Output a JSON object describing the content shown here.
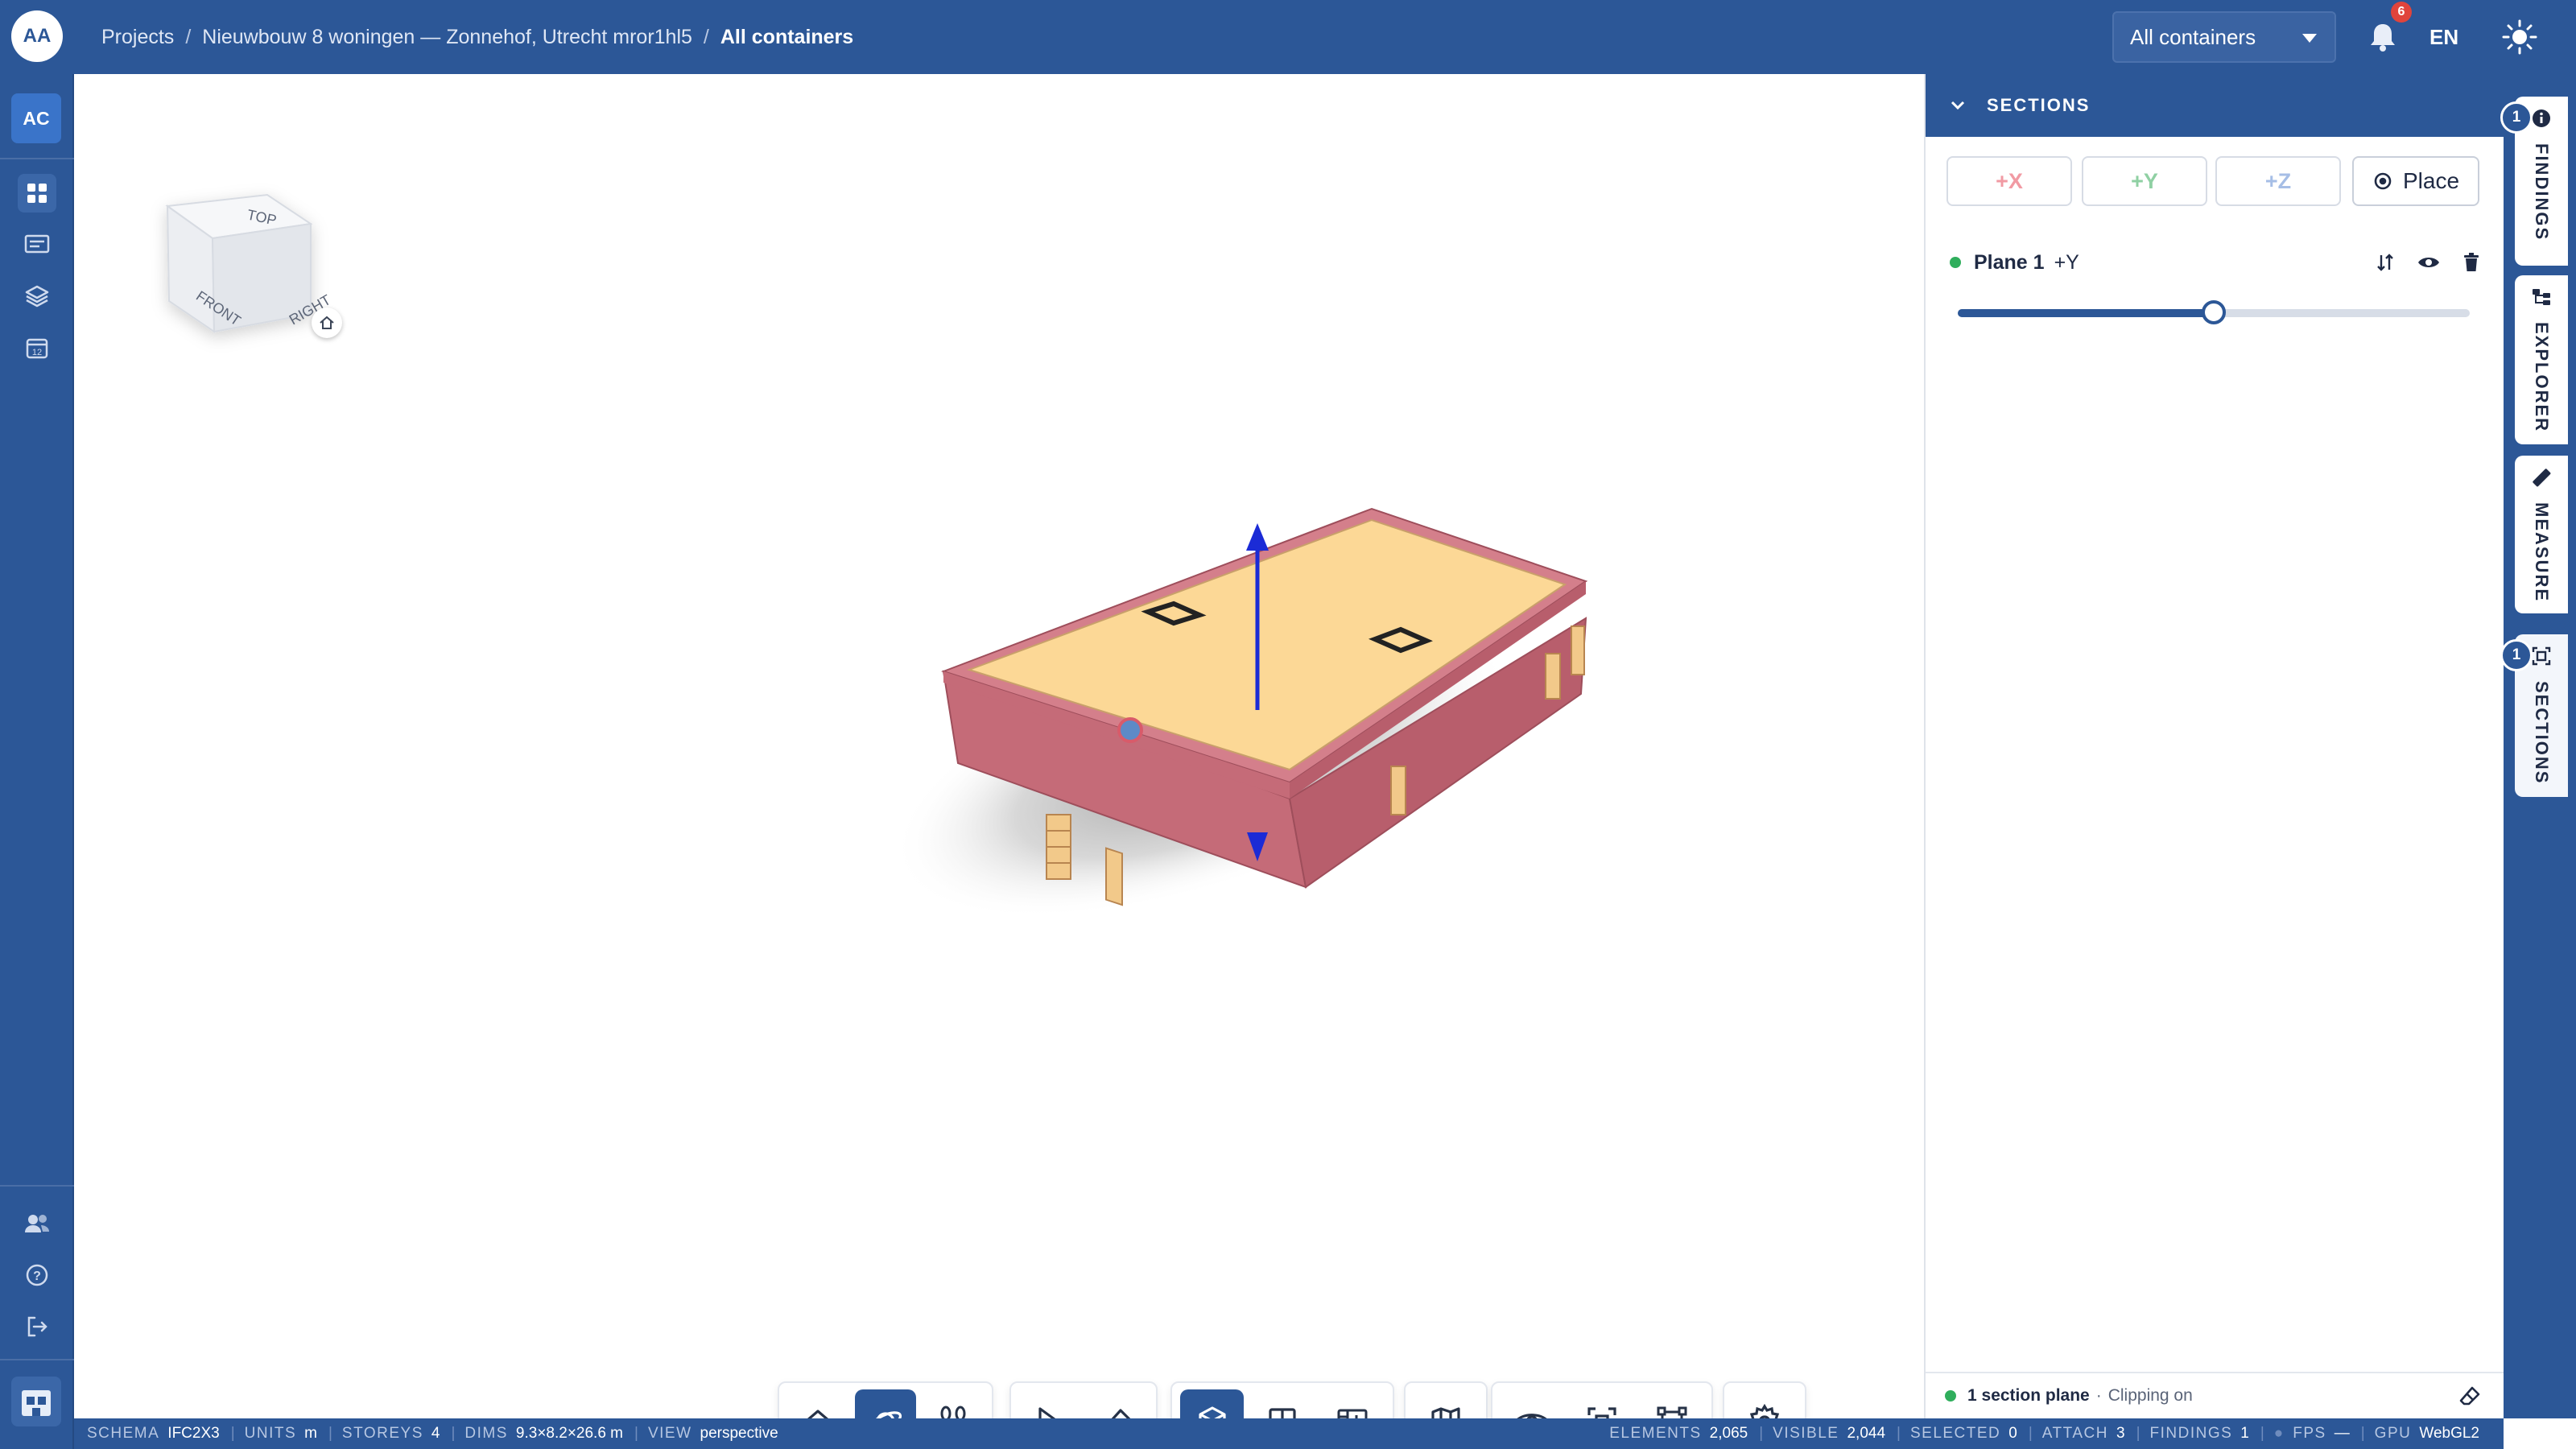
{
  "header": {
    "avatar": "AA",
    "breadcrumb": [
      {
        "label": "Projects"
      },
      {
        "label": "Nieuwbouw 8 woningen — Zonnehof, Utrecht mror1hl5"
      },
      {
        "label": "All containers"
      }
    ],
    "container_select": "All containers",
    "notifications_count": "6",
    "language": "EN"
  },
  "rail": {
    "org_badge": "AC"
  },
  "viewcube": {
    "top": "TOP",
    "front": "FRONT",
    "right": "RIGHT"
  },
  "sections_panel": {
    "title": "SECTIONS",
    "axis_buttons": [
      "+X",
      "+Y",
      "+Z"
    ],
    "place_label": "Place",
    "plane": {
      "name": "Plane 1",
      "axis": "+Y",
      "position": 0.5
    },
    "footer_count": "1 section plane",
    "footer_sep": "·",
    "footer_state": "Clipping on"
  },
  "side_tabs": [
    {
      "label": "FINDINGS",
      "badge": "1",
      "icon": "info-icon"
    },
    {
      "label": "EXPLORER",
      "badge": "",
      "icon": "tree-icon"
    },
    {
      "label": "MEASURE",
      "badge": "",
      "icon": "ruler-icon"
    },
    {
      "label": "SECTIONS",
      "badge": "1",
      "icon": "section-box-icon"
    }
  ],
  "status_bar": {
    "schema_k": "SCHEMA",
    "schema_v": "IFC2X3",
    "units_k": "UNITS",
    "units_v": "m",
    "storeys_k": "STOREYS",
    "storeys_v": "4",
    "dims_k": "DIMS",
    "dims_v": "9.3×8.2×26.6 m",
    "view_k": "VIEW",
    "view_v": "perspective",
    "elements_k": "ELEMENTS",
    "elements_v": "2,065",
    "visible_k": "VISIBLE",
    "visible_v": "2,044",
    "selected_k": "SELECTED",
    "selected_v": "0",
    "attach_k": "ATTACH",
    "attach_v": "3",
    "findings_k": "FINDINGS",
    "findings_v": "1",
    "fps_k": "FPS",
    "fps_v": "—",
    "gpu_k": "GPU",
    "gpu_v": "WebGL2"
  },
  "colors": {
    "brand": "#2c5797",
    "slab_top": "#fcd896",
    "walls": "#c56b78",
    "gizmo": "#1b2bd6"
  }
}
